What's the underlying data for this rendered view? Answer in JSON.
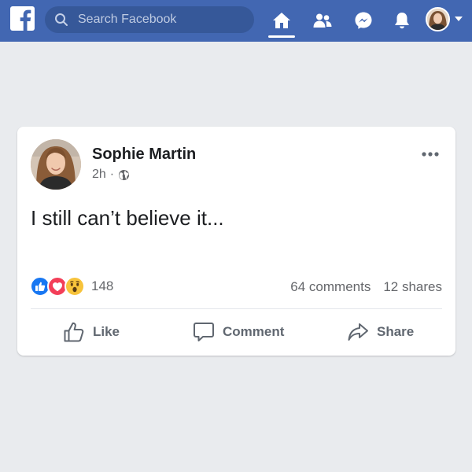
{
  "header": {
    "search": {
      "placeholder": "Search Facebook"
    },
    "nav": [
      "home-icon",
      "friends-icon",
      "messenger-icon",
      "notifications-icon"
    ],
    "brand_color": "#4267b2"
  },
  "post": {
    "author": "Sophie Martin",
    "time": "2h",
    "separator": "·",
    "text": "I still can’t believe it...",
    "reactions": {
      "types": [
        "like",
        "love",
        "wow"
      ],
      "count": "148"
    },
    "comments": "64 comments",
    "shares": "12 shares",
    "actions": {
      "like": "Like",
      "comment": "Comment",
      "share": "Share"
    }
  }
}
